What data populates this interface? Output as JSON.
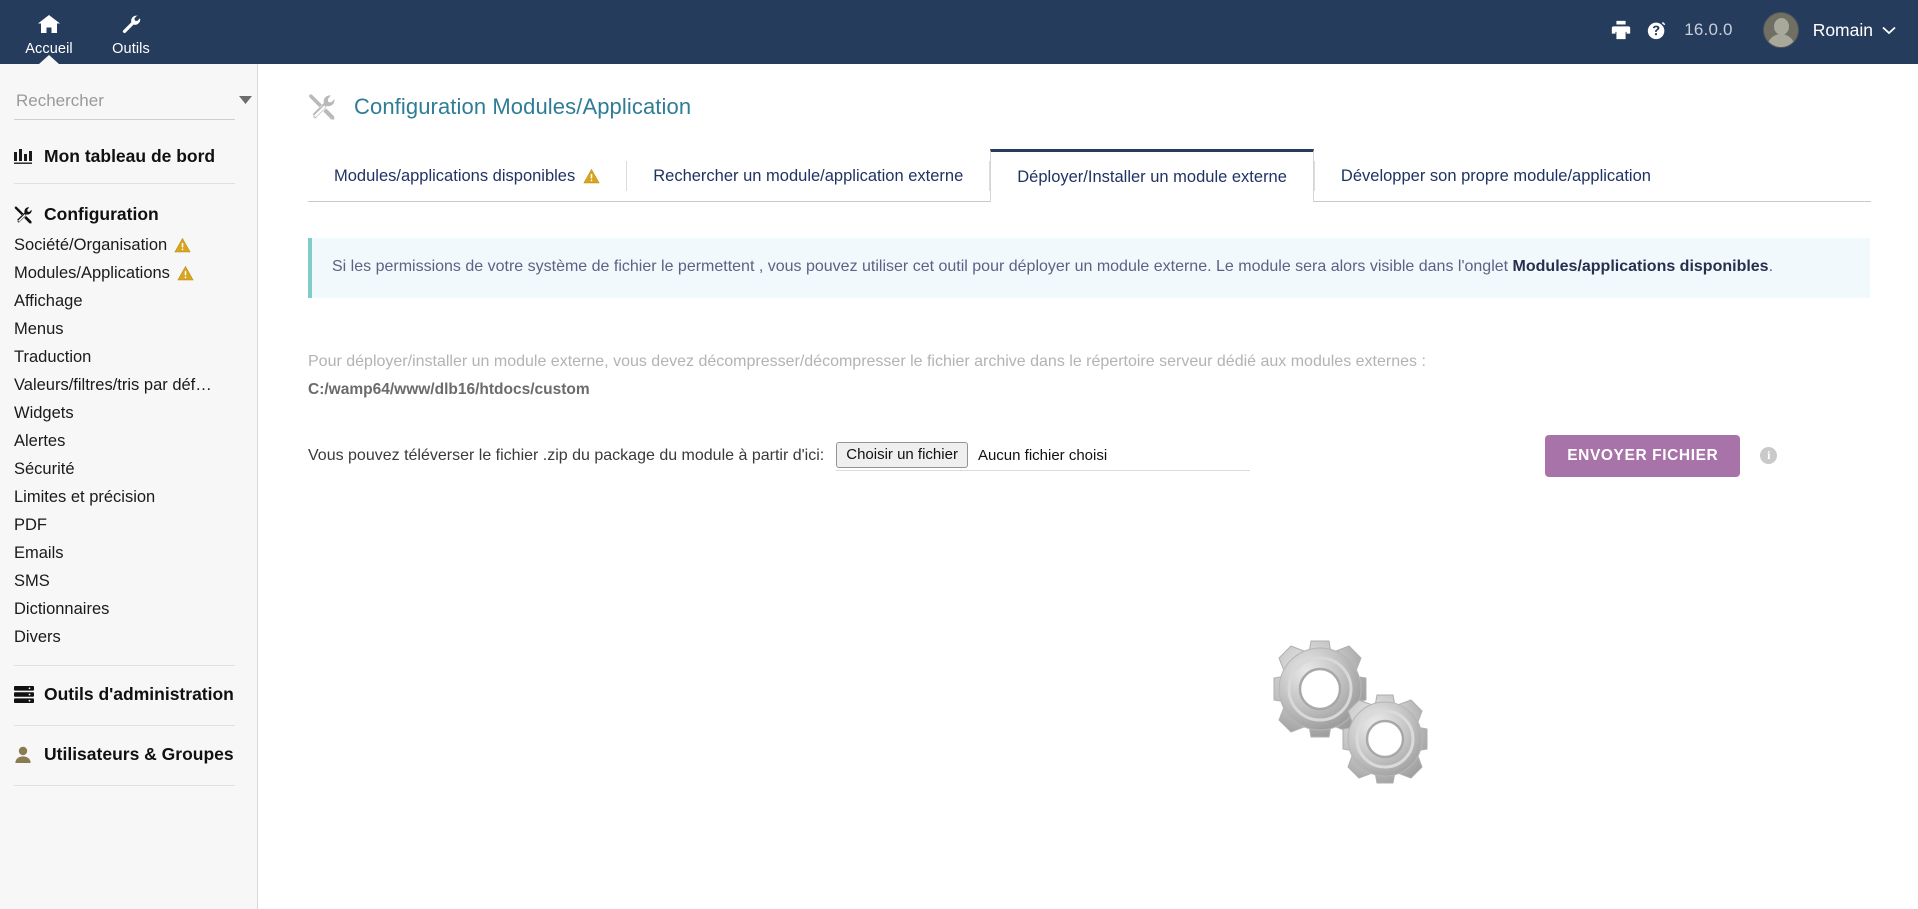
{
  "topbar": {
    "nav": [
      {
        "label": "Accueil",
        "icon": "home-icon",
        "active": true
      },
      {
        "label": "Outils",
        "icon": "wrench-icon",
        "active": false
      }
    ],
    "print_icon": "printer-icon",
    "help_icon": "help-question-icon",
    "version": "16.0.0",
    "user": "Romain",
    "user_caret": "⌄"
  },
  "sidebar": {
    "search": {
      "placeholder": "Rechercher",
      "value": "",
      "caret": "▼"
    },
    "dashboard": {
      "label": "Mon tableau de bord",
      "icon": "chart-bars-icon"
    },
    "configuration": {
      "label": "Configuration",
      "icon": "tools-icon",
      "items": [
        {
          "label": "Société/Organisation",
          "warning": true
        },
        {
          "label": "Modules/Applications",
          "warning": true
        },
        {
          "label": "Affichage",
          "warning": false
        },
        {
          "label": "Menus",
          "warning": false
        },
        {
          "label": "Traduction",
          "warning": false
        },
        {
          "label": "Valeurs/filtres/tris par déf…",
          "warning": false
        },
        {
          "label": "Widgets",
          "warning": false
        },
        {
          "label": "Alertes",
          "warning": false
        },
        {
          "label": "Sécurité",
          "warning": false
        },
        {
          "label": "Limites et précision",
          "warning": false
        },
        {
          "label": "PDF",
          "warning": false
        },
        {
          "label": "Emails",
          "warning": false
        },
        {
          "label": "SMS",
          "warning": false
        },
        {
          "label": "Dictionnaires",
          "warning": false
        },
        {
          "label": "Divers",
          "warning": false
        }
      ]
    },
    "admin_tools": {
      "label": "Outils d'administration",
      "icon": "server-icon"
    },
    "users_groups": {
      "label": "Utilisateurs & Groupes",
      "icon": "user-icon"
    }
  },
  "page": {
    "title": "Configuration Modules/Application",
    "title_icon": "tools-icon"
  },
  "tabs": [
    {
      "label": "Modules/applications disponibles",
      "warning": true,
      "active": false
    },
    {
      "label": "Rechercher un module/application externe",
      "warning": false,
      "active": false
    },
    {
      "label": "Déployer/Installer un module externe",
      "warning": false,
      "active": true
    },
    {
      "label": "Développer son propre module/application",
      "warning": false,
      "active": false
    }
  ],
  "banner": {
    "text_before": "Si les permissions de votre système de fichier le permettent , vous pouvez utiliser cet outil pour déployer un module externe. Le module sera alors visible dans l'onglet ",
    "bold": "Modules/applications disponibles",
    "text_after": "."
  },
  "deploy": {
    "instruction": "Pour déployer/installer un module externe, vous devez décompresser/décompresser le fichier archive dans le répertoire serveur dédié aux modules externes :",
    "path": "C:/wamp64/www/dlb16/htdocs/custom"
  },
  "upload": {
    "label": "Vous pouvez téléverser le fichier .zip du package du module à partir d'ici:",
    "file_button": "Choisir un fichier",
    "file_name": "Aucun fichier choisi",
    "submit": "ENVOYER FICHIER",
    "info_icon": "info-circle-icon"
  },
  "illustration": {
    "name": "gears-illustration"
  },
  "colors": {
    "topbar_bg": "#263c5c",
    "sidebar_bg": "#f7f7f7",
    "title_teal": "#2e7d95",
    "tab_text": "#1f3363",
    "banner_bg": "#f2f9fd",
    "banner_accent": "#7fcdc6",
    "submit_purple": "#a873a8",
    "warning_amber": "#d4a017"
  }
}
